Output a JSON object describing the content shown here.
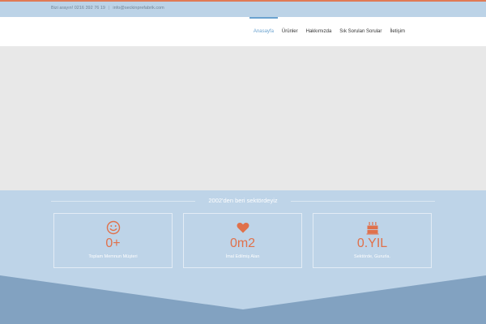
{
  "topbar": {
    "phone": "Bizi arayın! 0216 392 76 19",
    "separator": "|",
    "email": "info@seckinprefabrik.com"
  },
  "nav": {
    "items": [
      {
        "label": "Anasayfa",
        "active": true
      },
      {
        "label": "Ürünler",
        "active": false
      },
      {
        "label": "Hakkımızda",
        "active": false
      },
      {
        "label": "Sık Sorulan Sorular",
        "active": false
      },
      {
        "label": "İletişim",
        "active": false
      }
    ]
  },
  "stats": {
    "heading": "2002'den beri sektördeyiz",
    "items": [
      {
        "icon": "smile-icon",
        "value": "0+",
        "label": "Toplam Memnun Müşteri"
      },
      {
        "icon": "heart-icon",
        "value": "0m2",
        "label": "İmal Edilmiş Alan"
      },
      {
        "icon": "birthday-cake-icon",
        "value": "0.YIL",
        "label": "Sektörde, Gururla."
      }
    ]
  },
  "colors": {
    "accent": "#e0714b",
    "nav_active": "#6aa2cf",
    "topbar_bg": "#bcd3e7",
    "stats_bg": "#bed4e8",
    "stats_shape": "#82a2c1",
    "hero_bg": "#e8e8e8"
  }
}
